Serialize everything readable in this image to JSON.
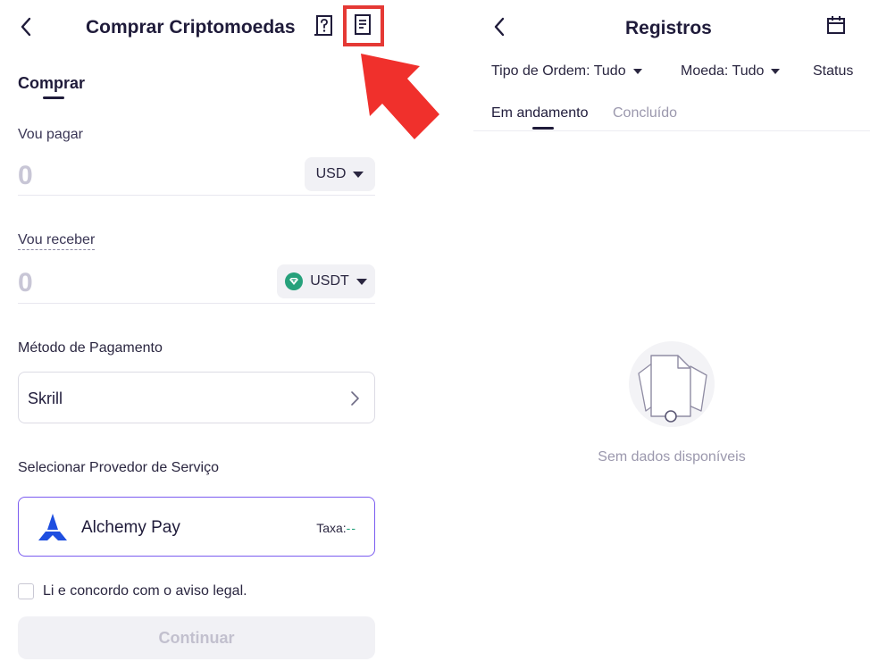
{
  "buy_screen": {
    "title": "Comprar Criptomoedas",
    "tab": "Comprar",
    "pay": {
      "label": "Vou pagar",
      "amount": "0",
      "currency": "USD"
    },
    "receive": {
      "label": "Vou receber",
      "amount": "0",
      "currency": "USDT"
    },
    "payment_method": {
      "label": "Método de Pagamento",
      "selected": "Skrill"
    },
    "provider": {
      "label": "Selecionar Provedor de Serviço",
      "name": "Alchemy Pay",
      "fee_label": "Taxa:",
      "fee_value": "--"
    },
    "legal": {
      "text": "Li e concordo com o aviso legal.",
      "checked": false
    },
    "continue_label": "Continuar",
    "icons": [
      "back-icon",
      "help-icon",
      "records-icon",
      "chevron-down-icon",
      "usdt-icon",
      "chevron-right-icon",
      "alchemy-pay-logo"
    ],
    "annotation": {
      "highlight_color": "#e53935"
    },
    "accent_color": "#7b5cf0"
  },
  "records_screen": {
    "title": "Registros",
    "filters": [
      {
        "label": "Tipo de Ordem: Tudo"
      },
      {
        "label": "Moeda: Tudo"
      },
      {
        "label": "Status"
      }
    ],
    "tabs": [
      {
        "label": "Em andamento",
        "active": true
      },
      {
        "label": "Concluído",
        "active": false
      }
    ],
    "empty_text": "Sem dados disponíveis",
    "icons": [
      "back-icon",
      "calendar-icon",
      "empty-document-icon"
    ]
  }
}
